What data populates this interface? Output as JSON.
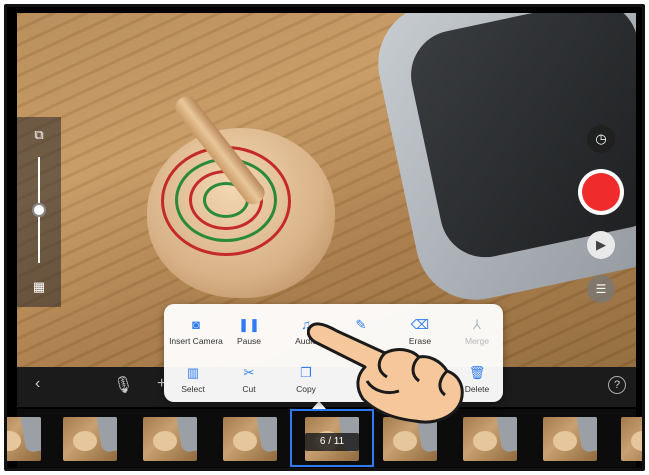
{
  "menu": {
    "items": [
      {
        "label": "Insert Camera",
        "icon": "camera-icon",
        "disabled": false
      },
      {
        "label": "Pause",
        "icon": "pause-icon",
        "disabled": false
      },
      {
        "label": "Audio",
        "icon": "music-note-icon",
        "disabled": false
      },
      {
        "label": "",
        "icon": "brush-icon",
        "disabled": false
      },
      {
        "label": "Erase",
        "icon": "eraser-icon",
        "disabled": false
      },
      {
        "label": "Merge",
        "icon": "merge-icon",
        "disabled": true
      },
      {
        "label": "Select",
        "icon": "select-frames-icon",
        "disabled": false
      },
      {
        "label": "Cut",
        "icon": "scissors-icon",
        "disabled": false
      },
      {
        "label": "Copy",
        "icon": "copy-icon",
        "disabled": false
      },
      {
        "label": "Delete",
        "icon": "trash-icon",
        "disabled": false
      }
    ]
  },
  "filmstrip": {
    "frame_counter": "6 / 11"
  },
  "toolbar": {
    "back": "‹",
    "add": "+",
    "help": "?"
  },
  "colors": {
    "accent": "#2f7bf3",
    "record": "#ef2b2b"
  }
}
